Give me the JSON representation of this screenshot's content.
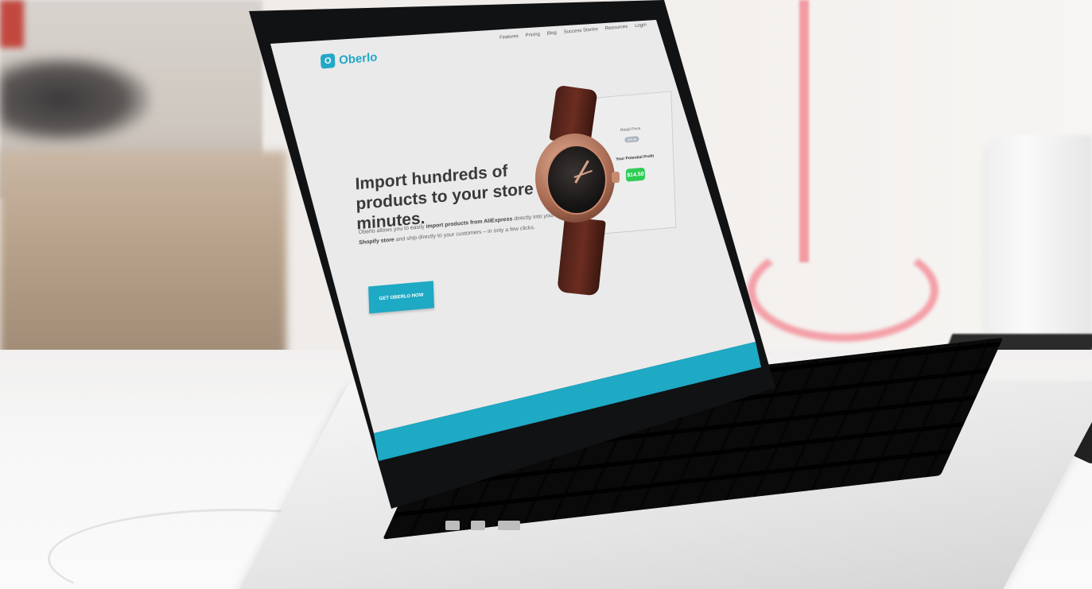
{
  "site": {
    "brand": "Oberlo",
    "brand_icon": "oberlo-logo-icon",
    "nav": [
      "Features",
      "Pricing",
      "Blog",
      "Success Stories",
      "Resources",
      "Login"
    ],
    "headline": "Import hundreds of products to your store in minutes.",
    "description": {
      "part1": "Oberlo allows you to easily ",
      "bold1": "import products from AliExpress",
      "part2": " directly into your ",
      "bold2": "Shopify store",
      "part3": " and ship directly to your customers – in only a few clicks."
    },
    "cta_label": "GET OBERLO NOW",
    "product_card": {
      "retail_label": "Retail Price",
      "retail_value": "$29.99",
      "profit_label": "Your Potential Profit",
      "profit_value": "$14.50"
    },
    "colors": {
      "accent": "#1ea9c4",
      "profit_green": "#2ecc55"
    }
  }
}
